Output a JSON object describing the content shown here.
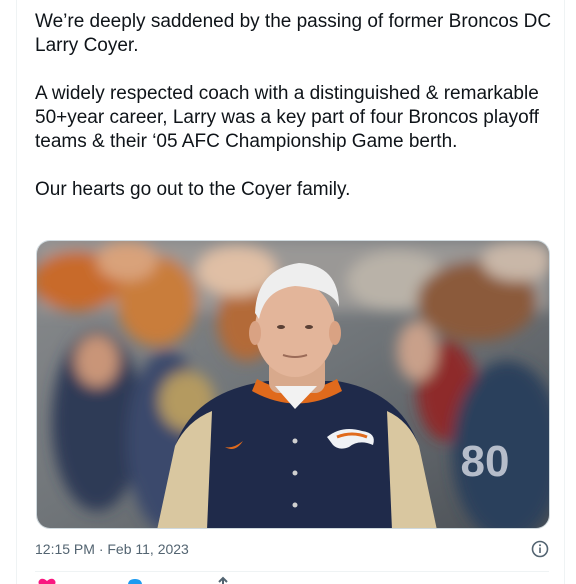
{
  "tweet": {
    "paragraphs": [
      "We’re deeply saddened by the passing of former Broncos DC Larry Coyer.",
      "A widely respected coach with a distinguished & remarkable 50+year career, Larry was a key part of four Broncos playoff teams & their ‘05 AFC Championship Game berth.",
      "Our hearts go out to the Coyer family."
    ],
    "timestamp": "12:15 PM · Feb 11, 2023"
  },
  "media": {
    "jersey_number": "80"
  },
  "icons": {
    "info": "info-icon",
    "like": "heart-icon",
    "reply": "reply-icon",
    "share": "share-icon"
  },
  "colors": {
    "text": "#0f1419",
    "muted": "#536471",
    "border": "#cfd9de",
    "like": "#f91880",
    "reply": "#1d9bf0"
  }
}
